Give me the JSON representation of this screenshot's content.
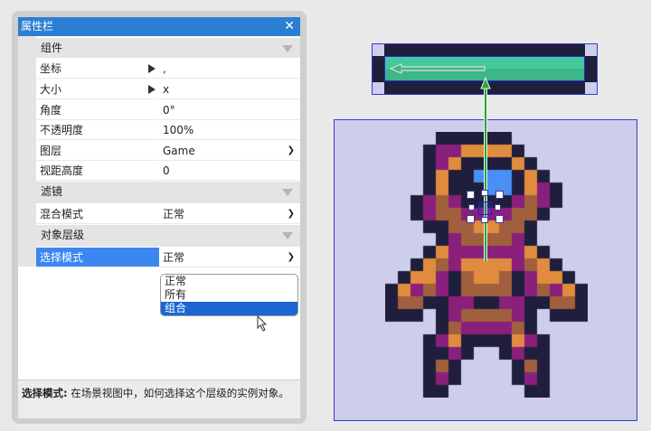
{
  "panel": {
    "title": "属性栏",
    "close_icon": "✕",
    "sections": {
      "component": "组件",
      "filter": "滤镜",
      "object_layer": "对象层级"
    },
    "props": {
      "position": {
        "label": "坐标",
        "value": ","
      },
      "size": {
        "label": "大小",
        "value": " x"
      },
      "angle": {
        "label": "角度",
        "value": "0°"
      },
      "opacity": {
        "label": "不透明度",
        "value": "100%"
      },
      "layer": {
        "label": "图层",
        "value": "Game"
      },
      "view_height": {
        "label": "视距高度",
        "value": "0"
      },
      "blend_mode": {
        "label": "混合模式",
        "value": "正常"
      },
      "select_mode": {
        "label": "选择模式",
        "value": "正常"
      }
    },
    "dropdown_options": [
      "正常",
      "所有",
      "组合"
    ],
    "dropdown_highlighted": "组合",
    "help": {
      "title": "选择模式:",
      "text": " 在场景视图中，如何选择这个层级的实例对象。"
    }
  },
  "colors": {
    "accent": "#2b7fd3",
    "selection": "#cdcdec",
    "bar_fill": "#46c99a"
  },
  "scene": {
    "health_bar_fill": 1.0
  }
}
